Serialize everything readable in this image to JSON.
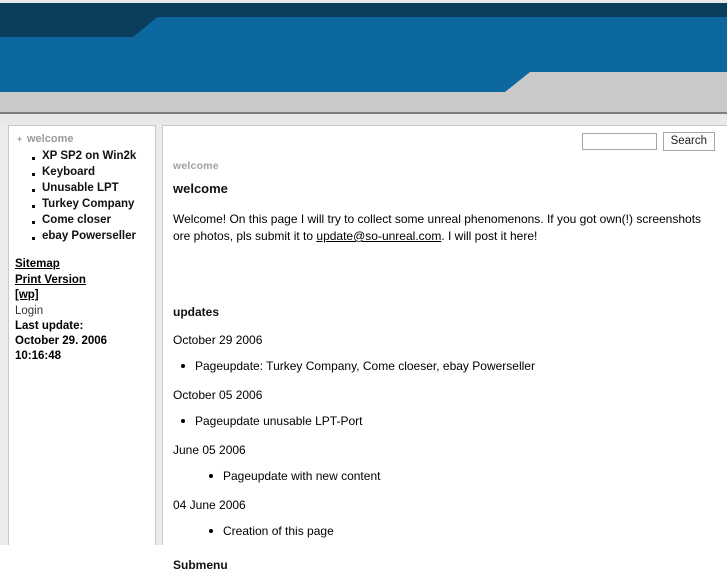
{
  "theme": {
    "navy": "#0b3d5c",
    "blue": "#0d68a0",
    "gray_band": "#c9c9c9",
    "page_bg": "#ececec",
    "rule": "#7d7d7d"
  },
  "sidebar": {
    "nav": {
      "parent_label": "welcome",
      "expander_glyph": "+",
      "items": [
        {
          "label": "XP SP2 on Win2k"
        },
        {
          "label": "Keyboard"
        },
        {
          "label": "Unusable LPT"
        },
        {
          "label": "Turkey Company"
        },
        {
          "label": "Come closer"
        },
        {
          "label": "ebay Powerseller"
        }
      ]
    },
    "links": [
      {
        "label": "Sitemap",
        "style": "link"
      },
      {
        "label": "Print Version",
        "style": "link"
      },
      {
        "label": "[wp]",
        "style": "link"
      },
      {
        "label": "Login",
        "style": "plain"
      }
    ],
    "last_update_label": "Last update:",
    "last_update_value": "October 29. 2006 10:16:48"
  },
  "search": {
    "value": "",
    "placeholder": "",
    "button_label": "Search"
  },
  "content": {
    "breadcrumb": "welcome",
    "title": "welcome",
    "intro_before": "Welcome! On this page I will try to collect some unreal phenomenons. If you got own(!) screenshots ore photos, pls submit it to ",
    "intro_link": "update@so-unreal.com",
    "intro_after": ". I will post it here!",
    "updates_heading": "updates",
    "updates": [
      {
        "date": "October 29 2006",
        "indented": false,
        "items": [
          "Pageupdate: Turkey Company, Come cloeser, ebay Powerseller"
        ]
      },
      {
        "date": "October 05 2006",
        "indented": false,
        "items": [
          "Pageupdate unusable LPT-Port"
        ]
      },
      {
        "date": "June 05 2006",
        "indented": true,
        "items": [
          "Pageupdate with new content"
        ]
      },
      {
        "date": "04 June 2006",
        "indented": true,
        "items": [
          "Creation of this page"
        ]
      }
    ],
    "submenu_heading": "Submenu"
  }
}
